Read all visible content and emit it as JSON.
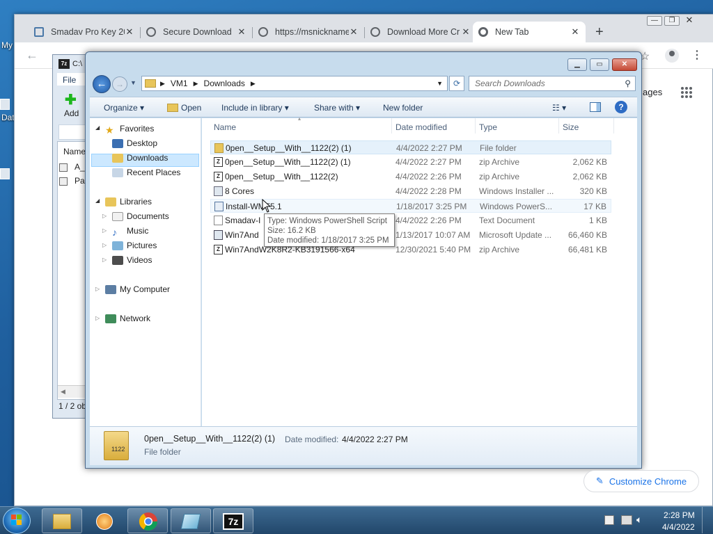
{
  "desktop": {
    "labels": [
      "My",
      "Dat"
    ]
  },
  "chrome": {
    "tabs": [
      {
        "label": "Smadav Pro Key 2022"
      },
      {
        "label": "Secure Download"
      },
      {
        "label": "https://msnicknames"
      },
      {
        "label": "Download More Cr"
      },
      {
        "label": "New Tab"
      }
    ],
    "new_tab_symbol": "+",
    "ntp_link": "ages",
    "customize_label": "Customize Chrome"
  },
  "sevenzip": {
    "title": "C:\\",
    "menu": "File",
    "add_label": "Add",
    "col": "Name",
    "rows": [
      "A_",
      "Pas"
    ],
    "status": "1 / 2 ob"
  },
  "explorer": {
    "breadcrumb": [
      "VM1",
      "Downloads"
    ],
    "search_placeholder": "Search Downloads",
    "commands": {
      "organize": "Organize",
      "open": "Open",
      "include": "Include in library",
      "share": "Share with",
      "new_folder": "New folder"
    },
    "nav": {
      "favorites": "Favorites",
      "desktop": "Desktop",
      "downloads": "Downloads",
      "recent": "Recent Places",
      "libraries": "Libraries",
      "documents": "Documents",
      "music": "Music",
      "pictures": "Pictures",
      "videos": "Videos",
      "computer": "My Computer",
      "network": "Network"
    },
    "columns": {
      "name": "Name",
      "date": "Date modified",
      "type": "Type",
      "size": "Size"
    },
    "files": [
      {
        "name": "0pen__Setup__With__1122(2) (1)",
        "date": "4/4/2022 2:27 PM",
        "type": "File folder",
        "size": ""
      },
      {
        "name": "0pen__Setup__With__1122(2) (1)",
        "date": "4/4/2022 2:27 PM",
        "type": "zip Archive",
        "size": "2,062 KB"
      },
      {
        "name": "0pen__Setup__With__1122(2)",
        "date": "4/4/2022 2:26 PM",
        "type": "zip Archive",
        "size": "2,062 KB"
      },
      {
        "name": "8 Cores",
        "date": "4/4/2022 2:28 PM",
        "type": "Windows Installer ...",
        "size": "320 KB"
      },
      {
        "name": "Install-WMF5.1",
        "date": "1/18/2017 3:25 PM",
        "type": "Windows PowerS...",
        "size": "17 KB"
      },
      {
        "name": "Smadav-I",
        "date": "4/4/2022 2:26 PM",
        "type": "Text Document",
        "size": "1 KB"
      },
      {
        "name": "Win7And",
        "date": "1/13/2017 10:07 AM",
        "type": "Microsoft Update ...",
        "size": "66,460 KB"
      },
      {
        "name": "Win7AndW2K8R2-KB3191566-x64",
        "date": "12/30/2021 5:40 PM",
        "type": "zip Archive",
        "size": "66,481 KB"
      }
    ],
    "tooltip": {
      "type": "Type: Windows PowerShell Script",
      "size": "Size: 16.2 KB",
      "date": "Date modified: 1/18/2017 3:25 PM"
    },
    "details": {
      "name": "0pen__Setup__With__1122(2) (1)",
      "date_label": "Date modified:",
      "date": "4/4/2022 2:27 PM",
      "type": "File folder",
      "thumb_text": "1122"
    }
  },
  "taskbar": {
    "time": "2:28 PM",
    "date": "4/4/2022",
    "sevenzip_label": "7z"
  }
}
